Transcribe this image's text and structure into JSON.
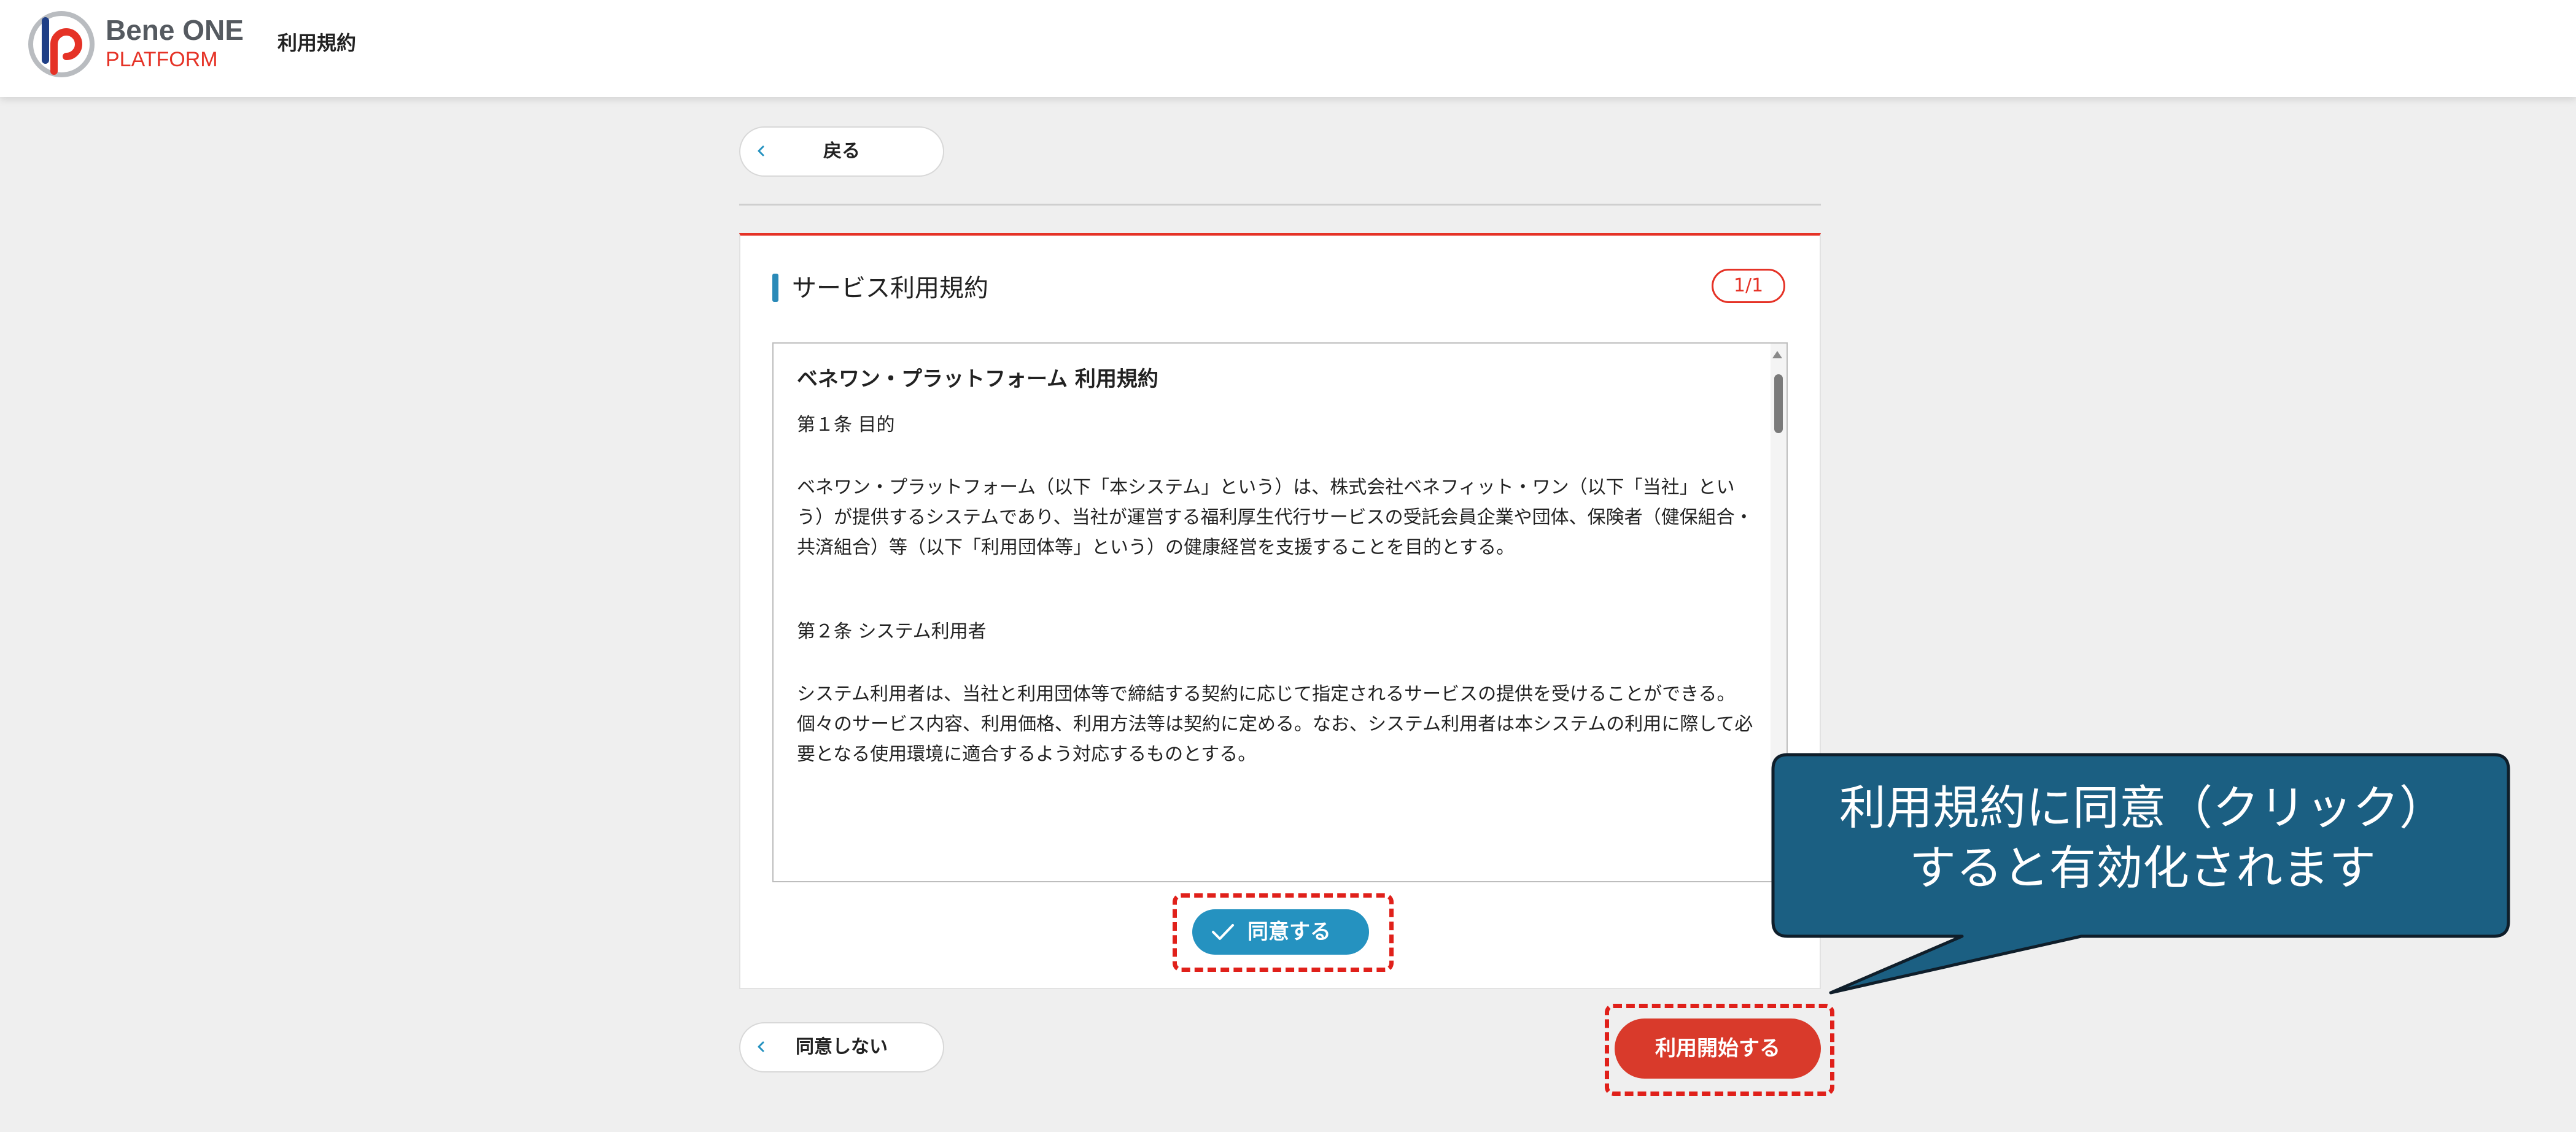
{
  "header": {
    "logo": {
      "brand_main": "Bene ONE",
      "brand_sub": "PLATFORM"
    },
    "page_title": "利用規約"
  },
  "nav": {
    "back_label": "戻る",
    "back_icon": "chevron-left-icon",
    "disagree_label": "同意しない",
    "disagree_icon": "chevron-left-icon"
  },
  "card": {
    "title": "サービス利用規約",
    "page_indicator": "1/1"
  },
  "terms": {
    "heading": "ベネワン・プラットフォーム 利用規約",
    "articles": [
      {
        "title": "第１条 目的",
        "body": "ベネワン・プラットフォーム（以下「本システム」という）は、株式会社ベネフィット・ワン（以下「当社」という）が提供するシステムであり、当社が運営する福利厚生代行サービスの受託会員企業や団体、保険者（健保組合・共済組合）等（以下「利用団体等」という）の健康経営を支援することを目的とする。"
      },
      {
        "title": "第２条 システム利用者",
        "body": "システム利用者は、当社と利用団体等で締結する契約に応じて指定されるサービスの提供を受けることができる。個々のサービス内容、利用価格、利用方法等は契約に定める。なお、システム利用者は本システムの利用に際して必要となる使用環境に適合するよう対応するものとする。"
      }
    ]
  },
  "actions": {
    "agree_label": "同意する",
    "agree_icon": "check-icon",
    "start_label": "利用開始する"
  },
  "annotation": {
    "callout_text": "利用規約に同意（クリック）\nすると有効化されます"
  },
  "colors": {
    "brand_red": "#e53226",
    "accent_blue": "#2592c0",
    "start_button": "#d93a2b",
    "callout_fill": "#1b5f82",
    "highlight_dash": "#e0201a"
  }
}
